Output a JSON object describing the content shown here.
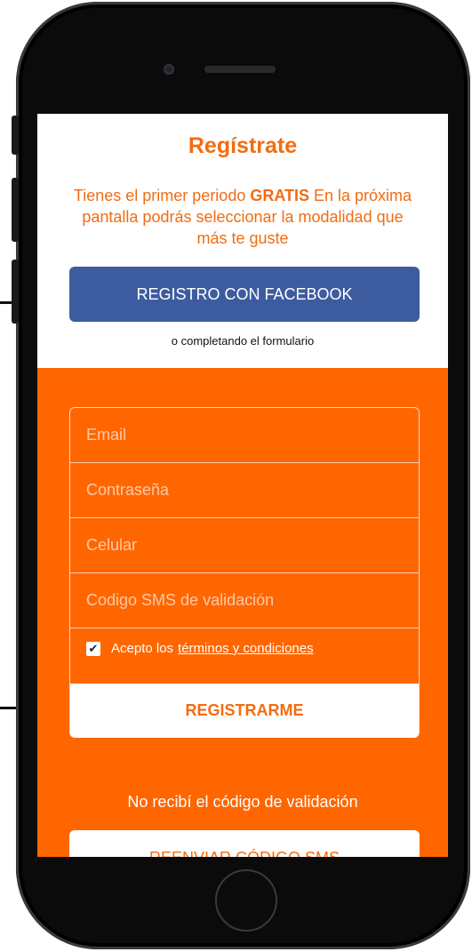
{
  "header": {
    "title": "Regístrate",
    "subtitle_part1": "Tienes el primer periodo ",
    "subtitle_bold": "GRATIS",
    "subtitle_part2": " En la próxima pantalla podrás seleccionar la modalidad que más te guste"
  },
  "facebook_button": {
    "label": "REGISTRO CON FACEBOOK"
  },
  "alt_text": "o completando el formulario",
  "form": {
    "email_placeholder": "Email",
    "password_placeholder": "Contraseña",
    "phone_placeholder": "Celular",
    "sms_code_placeholder": "Codigo SMS de validación",
    "terms_prefix": "Acepto los",
    "terms_link": "términos y condiciones",
    "terms_checked": true,
    "submit_label": "REGISTRARME"
  },
  "no_code_text": "No recibí el código de validación",
  "resend_button": {
    "label": "REENVIAR CÓDIGO SMS"
  },
  "colors": {
    "accent_orange": "#ff6600",
    "title_orange": "#f26c11",
    "facebook_blue": "#3d5c9f"
  }
}
